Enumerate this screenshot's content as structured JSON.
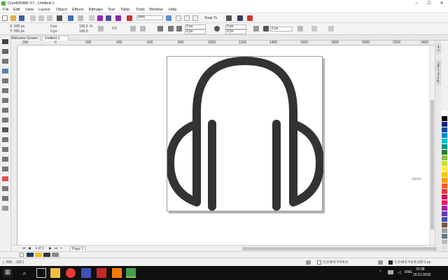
{
  "window": {
    "title": "CorelDRAW X7 - Untitled-1",
    "min": "–",
    "max": "☐",
    "close": "✕"
  },
  "menu": [
    "File",
    "Edit",
    "View",
    "Layout",
    "Object",
    "Effects",
    "Bitmaps",
    "Text",
    "Table",
    "Tools",
    "Window",
    "Help"
  ],
  "toolbar": {
    "zoom": "50%",
    "snap_to": "Snap To"
  },
  "property_bar": {
    "x": "X: 500 px",
    "y": "Y: 500 px",
    "w": "0 px",
    "h": "0 px",
    "scale_w": "100,0",
    "scale_h": "100,0",
    "pct": "%",
    "angle": "0,0",
    "corner1": "0 px",
    "corner2": "0 px",
    "corner3": "0 px",
    "corner4": "0 px",
    "outline": "2 px"
  },
  "tabs": [
    {
      "label": "Welcome Screen"
    },
    {
      "label": "Untitled-1"
    }
  ],
  "ruler": {
    "ticks": [
      "200",
      "0",
      "200",
      "400",
      "600",
      "800",
      "1000",
      "1200",
      "1400",
      "1600",
      "1800",
      "2000",
      "2200",
      "2400"
    ],
    "unit": "pixels"
  },
  "dockers": {
    "hints": "Hints",
    "object_manager": "Object Manager"
  },
  "page_nav": {
    "counter": "1 of 1",
    "page_tab": "Page 1"
  },
  "status": {
    "coords": "( -208 , -192 )",
    "fill": "C:0 M:0 Y:0 K:0",
    "outline": "C:0 M:0 Y:0 K:100  2 px"
  },
  "taskbar": {
    "lang": "ENG",
    "time": "20:38",
    "date": "15.01.2018"
  },
  "palette_colors": [
    "#ffffff",
    "#000000",
    "#1a237e",
    "#0d47a1",
    "#0288d1",
    "#00bcd4",
    "#009688",
    "#2e7d32",
    "#8bc34a",
    "#cddc39",
    "#ffeb3b",
    "#ffc107",
    "#ff9800",
    "#ff5722",
    "#e53935",
    "#c2185b",
    "#e91e63",
    "#9c27b0",
    "#673ab7",
    "#3f51b5",
    "#795548",
    "#9e9e9e",
    "#607d8b",
    "#bdbdbd",
    "#e0e0e0",
    "#f8bbd0",
    "#b2dfdb",
    "#bbdefb",
    "#fff9c4",
    "#d7ccc8",
    "#cfd8dc"
  ],
  "artwork": {
    "stroke_color": "#333333"
  }
}
